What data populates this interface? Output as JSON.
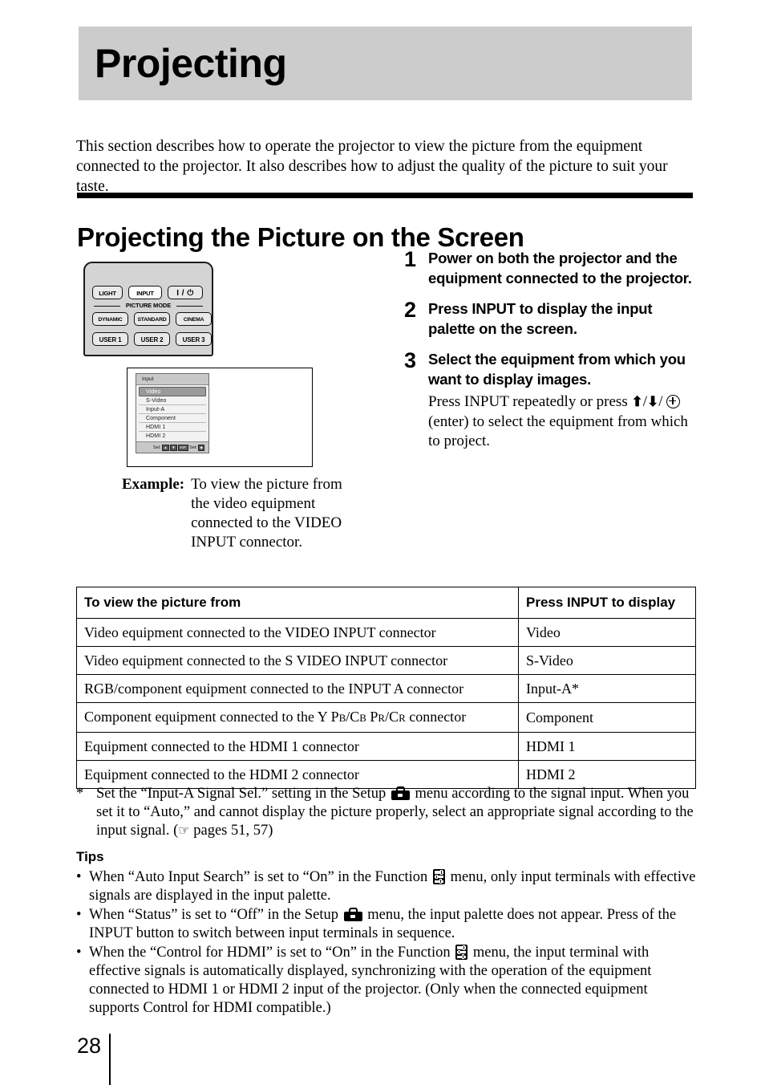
{
  "chapter": {
    "title": "Projecting"
  },
  "intro": "This section describes how to operate the projector to view the picture from the equipment connected to the projector. It also describes how to adjust the quality of the picture to suit your taste.",
  "section": {
    "title": "Projecting the Picture on the Screen"
  },
  "remote": {
    "buttons": {
      "light": "LIGHT",
      "input": "INPUT",
      "power": "I / ⏻",
      "dynamic": "DYNAMIC",
      "standard": "STANDARD",
      "cinema": "CINEMA",
      "user1": "USER 1",
      "user2": "USER 2",
      "user3": "USER 3"
    },
    "picture_mode_label": "PICTURE MODE"
  },
  "palette": {
    "title": "Input",
    "items": [
      "Video",
      "S-Video",
      "Input-A",
      "Component",
      "HDMI 1",
      "HDMI 2"
    ],
    "selected": "Video",
    "footer_sel_label": "Sel:",
    "footer_set_label": "Set:"
  },
  "example": {
    "label": "Example:",
    "text": "To view the picture from the video equipment connected to the VIDEO INPUT connector."
  },
  "steps": [
    {
      "number": "1",
      "heading": "Power on both the projector and the equipment connected to the projector.",
      "sub": ""
    },
    {
      "number": "2",
      "heading": "Press INPUT to display the input palette on the screen.",
      "sub": ""
    },
    {
      "number": "3",
      "heading": "Select the equipment from which you want to display images.",
      "sub_pre": "Press INPUT repeatedly or press ",
      "sub_mid": "/",
      "sub_post": " (enter) to select the equipment from which to project."
    }
  ],
  "table": {
    "headers": [
      "To view the picture from",
      "Press INPUT to display"
    ],
    "rows": [
      {
        "source": "Video equipment connected to the VIDEO INPUT connector",
        "display": "Video"
      },
      {
        "source": "Video equipment connected to the S VIDEO INPUT connector",
        "display": "S-Video"
      },
      {
        "source": "RGB/component equipment connected to the INPUT A connector",
        "display": "Input-A*"
      },
      {
        "source_pre": "Component equipment connected to the Y P",
        "source_sub1": "B",
        "source_mid1": "/C",
        "source_sub2": "B",
        "source_mid2": " P",
        "source_sub3": "R",
        "source_mid3": "/C",
        "source_sub4": "R",
        "source_post": " connector",
        "display": "Component"
      },
      {
        "source": "Equipment connected to the HDMI 1 connector",
        "display": "HDMI 1"
      },
      {
        "source": "Equipment connected to the HDMI 2 connector",
        "display": "HDMI 2"
      }
    ]
  },
  "footnote": {
    "mark": "*",
    "part1": "Set the “Input-A Signal Sel.” setting in the Setup ",
    "part2": " menu according to the signal input. When you set it to “Auto,” and cannot display the picture properly, select an appropriate signal according to the input signal. (",
    "part3": " pages 51,  57)"
  },
  "tips": {
    "title": "Tips",
    "bullet": "•",
    "items": [
      {
        "part1": "When “Auto Input Search” is set to “On” in the Function ",
        "icon": "function-icon",
        "part2": " menu, only input terminals with effective signals are displayed in the input palette."
      },
      {
        "part1": "When “Status” is set to “Off” in the Setup ",
        "icon": "setup-icon",
        "part2": " menu, the input palette does not appear. Press of the INPUT button to switch between input terminals in sequence."
      },
      {
        "part1": "When the “Control for HDMI” is set to “On” in the Function ",
        "icon": "function-icon",
        "part2": " menu, the input terminal with effective signals is automatically displayed, synchronizing with the operation of the equipment connected to HDMI 1 or HDMI 2 input of the projector. (Only when the connected equipment supports Control for HDMI compatible.)"
      }
    ]
  },
  "page": {
    "number": "28"
  },
  "colors": {
    "banner_bg": "#cccccc",
    "text": "#000000",
    "remote_body": "#d4d4d4",
    "palette_title_bg": "#c8c8c8",
    "palette_selected_bg": "#9a9a9a"
  }
}
